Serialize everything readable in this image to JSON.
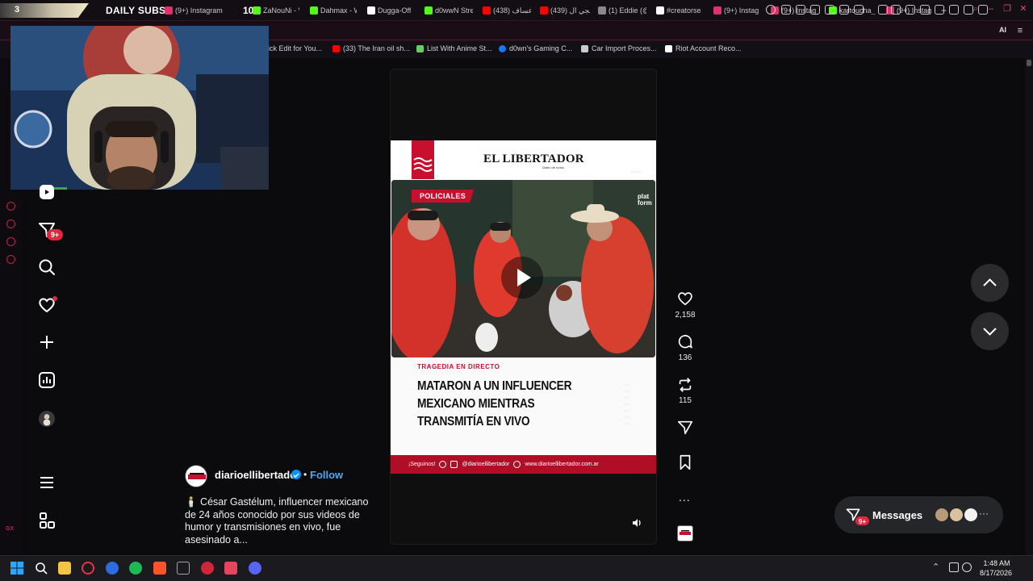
{
  "browser": {
    "subscriber_widget": {
      "number": "3",
      "title": "DAILY SUBS",
      "count": "10"
    },
    "tabs": [
      {
        "label": "(9+) Instagram",
        "icon": "instagram-icon",
        "color": "#e1306c"
      },
      {
        "label": "ZaNouNi - V",
        "icon": "kick-icon",
        "color": "#53fc18"
      },
      {
        "label": "Dahmax - W",
        "icon": "kick-icon",
        "color": "#53fc18"
      },
      {
        "label": "Dugga-Off",
        "icon": "tiktok-icon",
        "color": "#ffffff"
      },
      {
        "label": "d0wwN Stre",
        "icon": "kick-icon",
        "color": "#53fc18"
      },
      {
        "label": "(438) عساف",
        "icon": "youtube-icon",
        "color": "#ff0000"
      },
      {
        "label": "(439) لجي ال",
        "icon": "youtube-icon",
        "color": "#ff0000"
      },
      {
        "label": "(1) Eddie (@",
        "icon": "x-icon",
        "color": "#ffffff"
      },
      {
        "label": "#creatorse",
        "icon": "tiktok-icon",
        "color": "#ffffff"
      },
      {
        "label": "(9+) Instag",
        "icon": "instagram-icon",
        "color": "#e1306c"
      },
      {
        "label": "(9+) Instag",
        "icon": "instagram-icon",
        "color": "#e1306c"
      },
      {
        "label": "kartoucha_",
        "icon": "kick-icon",
        "color": "#53fc18"
      },
      {
        "label": "(9+) Instag",
        "icon": "instagram-icon",
        "color": "#e1306c"
      }
    ],
    "new_tab": "+",
    "toolbar_ai": "AI",
    "bookmarks": [
      {
        "label": "ick Edit for You...",
        "color": "#888888"
      },
      {
        "label": "(33) The Iran oil sh...",
        "color": "#ff0000"
      },
      {
        "label": "List With Anime St...",
        "color": "#66cc66"
      },
      {
        "label": "d0wn's Gaming C...",
        "color": "#1877f2"
      },
      {
        "label": "Car Import Proces...",
        "color": "#cccccc"
      },
      {
        "label": "Riot Account Reco...",
        "color": "#ffffff"
      }
    ],
    "gx_label": "GX"
  },
  "instagram": {
    "nav": {
      "messages_badge": "9+",
      "items": [
        "reels-icon",
        "messages-icon",
        "search-icon",
        "notifications-icon",
        "create-icon",
        "dashboard-icon",
        "profile-avatar",
        "menu-icon",
        "more-apps-icon"
      ]
    },
    "reel": {
      "card": {
        "paper_name": "EL LIBERTADOR",
        "paper_tagline": "Diario de todos",
        "category_tag": "POLICIALES",
        "watermark": "plat form",
        "kicker": "TRAGEDIA EN DIRECTO",
        "headline": "MATARON A UN INFLUENCER MEXICANO MIENTRAS TRANSMITÍA EN VIVO",
        "footer_follow": "¡Seguinos!",
        "footer_handle": "@diarioellibertador",
        "footer_site": "www.diarioellibertador.com.ar"
      },
      "author": "diarioellibertador",
      "follow_label": "Follow",
      "separator": "•",
      "caption": "🕯️ César Gastélum, influencer mexicano de 24 años conocido por sus videos de humor y transmisiones en vivo, fue asesinado a..."
    },
    "actions": {
      "likes": "2,158",
      "comments": "136",
      "reposts": "115",
      "more": "..."
    },
    "messages": {
      "label": "Messages",
      "badge": "9+",
      "more": "···"
    }
  },
  "taskbar": {
    "time": "1:48 AM",
    "date": "8/17/2026"
  },
  "colors": {
    "accent": "#c8102e",
    "instagram_badge": "#e5243d",
    "follow_blue": "#4aa8f5"
  }
}
